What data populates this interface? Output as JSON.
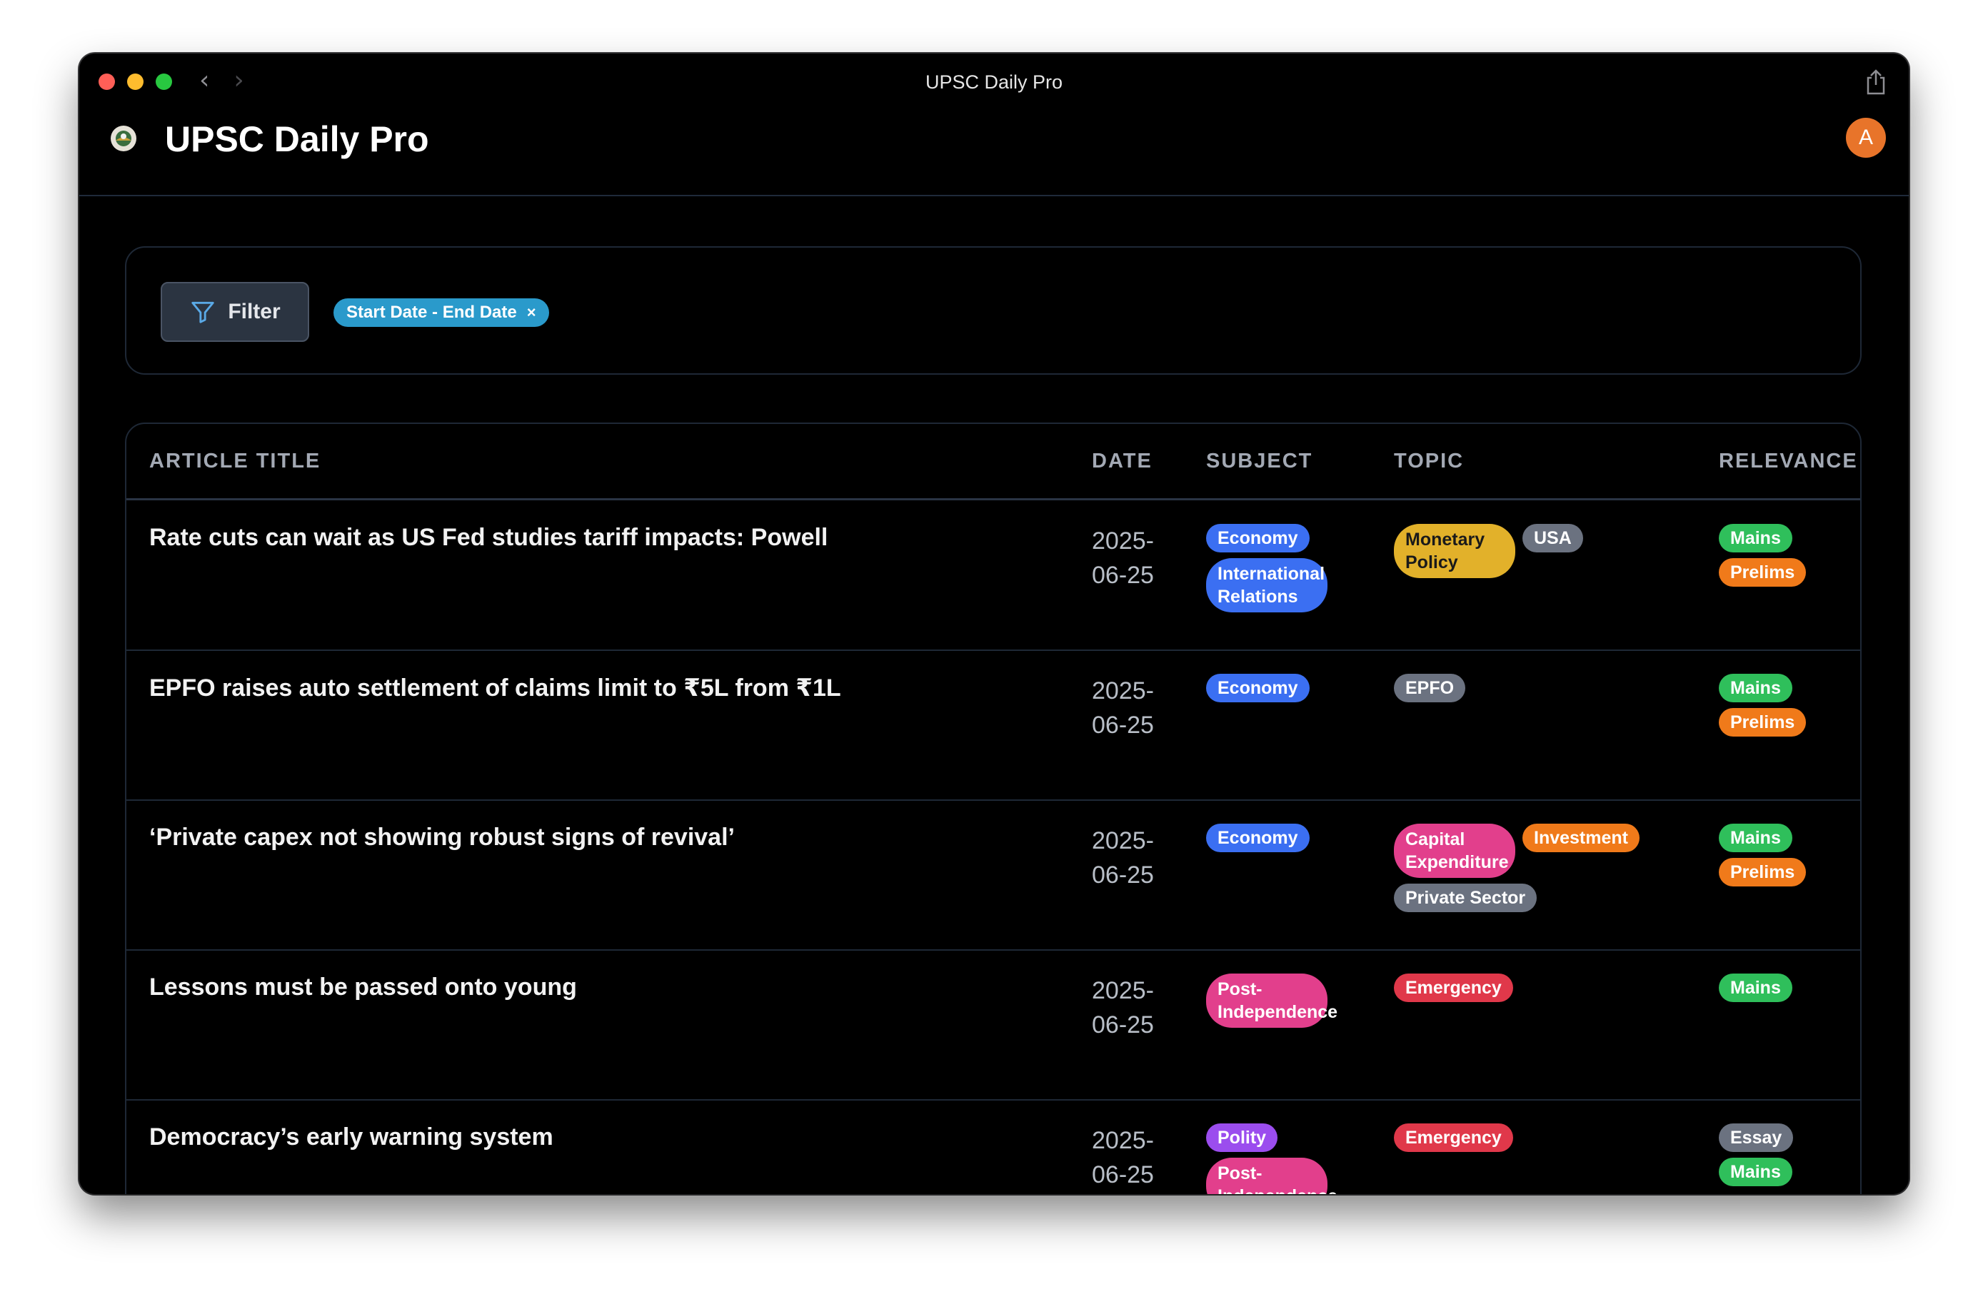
{
  "window": {
    "title": "UPSC Daily Pro"
  },
  "app": {
    "title": "UPSC Daily Pro",
    "avatar_letter": "A"
  },
  "filter": {
    "button_label": "Filter",
    "chip_label": "Start Date - End Date",
    "chip_close": "×"
  },
  "table": {
    "headers": {
      "title": "ARTICLE TITLE",
      "date": "DATE",
      "subject": "SUBJECT",
      "topic": "TOPIC",
      "relevance": "RELEVANCE"
    },
    "rows": [
      {
        "title": "Rate cuts can wait as US Fed studies tariff impacts: Powell",
        "date": "2025-06-25",
        "subjects": [
          {
            "label": "Economy",
            "color": "#3b6ff2"
          },
          {
            "label": "International Relations",
            "color": "#3b6ff2"
          }
        ],
        "topics": [
          {
            "label": "Monetary Policy",
            "color": "#e2b12a",
            "text_color": "#1a1a1a"
          },
          {
            "label": "USA",
            "color": "#6b7280"
          }
        ],
        "relevance": [
          {
            "label": "Mains",
            "color": "#2fbf5b"
          },
          {
            "label": "Prelims",
            "color": "#f07a1a"
          }
        ]
      },
      {
        "title": "EPFO raises auto settlement of claims limit to ₹5L from ₹1L",
        "date": "2025-06-25",
        "subjects": [
          {
            "label": "Economy",
            "color": "#3b6ff2"
          }
        ],
        "topics": [
          {
            "label": "EPFO",
            "color": "#6b7280"
          }
        ],
        "relevance": [
          {
            "label": "Mains",
            "color": "#2fbf5b"
          },
          {
            "label": "Prelims",
            "color": "#f07a1a"
          }
        ]
      },
      {
        "title": "‘Private capex not showing robust signs of revival’",
        "date": "2025-06-25",
        "subjects": [
          {
            "label": "Economy",
            "color": "#3b6ff2"
          }
        ],
        "topics": [
          {
            "label": "Capital Expenditure",
            "color": "#e23f8c"
          },
          {
            "label": "Investment",
            "color": "#f07a1a"
          },
          {
            "label": "Private Sector",
            "color": "#6b7280"
          }
        ],
        "relevance": [
          {
            "label": "Mains",
            "color": "#2fbf5b"
          },
          {
            "label": "Prelims",
            "color": "#f07a1a"
          }
        ]
      },
      {
        "title": "Lessons must be passed onto young",
        "date": "2025-06-25",
        "subjects": [
          {
            "label": "Post-Independence",
            "color": "#e23f8c"
          }
        ],
        "topics": [
          {
            "label": "Emergency",
            "color": "#e0384a"
          }
        ],
        "relevance": [
          {
            "label": "Mains",
            "color": "#2fbf5b"
          }
        ]
      },
      {
        "title": "Democracy’s early warning system",
        "date": "2025-06-25",
        "subjects": [
          {
            "label": "Polity",
            "color": "#9b4dee"
          },
          {
            "label": "Post-Independence",
            "color": "#e23f8c"
          }
        ],
        "topics": [
          {
            "label": "Emergency",
            "color": "#e0384a"
          }
        ],
        "relevance": [
          {
            "label": "Essay",
            "color": "#6b7280"
          },
          {
            "label": "Mains",
            "color": "#2fbf5b"
          }
        ]
      }
    ]
  }
}
